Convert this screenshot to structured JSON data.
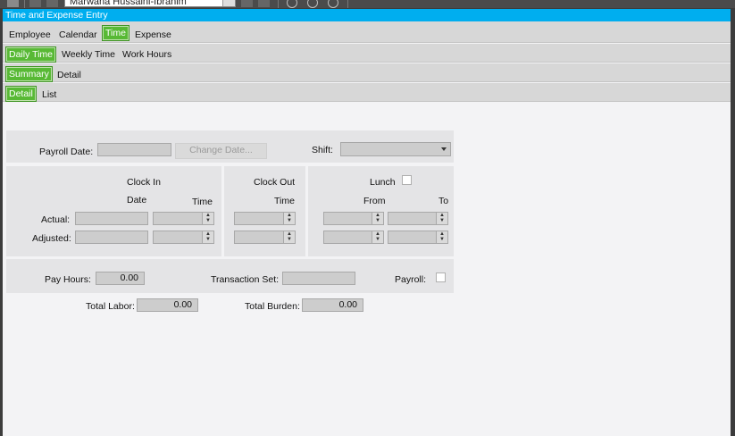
{
  "toolbar": {
    "user": "Marwana Hussaini-Ibrahim"
  },
  "window": {
    "title": "Time and Expense Entry"
  },
  "tabs_main": [
    {
      "label": "Employee"
    },
    {
      "label": "Calendar"
    },
    {
      "label": "Time"
    },
    {
      "label": "Expense"
    }
  ],
  "tabs_time": [
    {
      "label": "Daily Time"
    },
    {
      "label": "Weekly Time"
    },
    {
      "label": "Work Hours"
    }
  ],
  "tabs_daily": [
    {
      "label": "Summary"
    },
    {
      "label": "Detail"
    }
  ],
  "tabs_summary": [
    {
      "label": "Detail"
    },
    {
      "label": "List"
    }
  ],
  "form": {
    "payroll_date_label": "Payroll Date:",
    "change_date_button": "Change Date...",
    "shift_label": "Shift:",
    "clock_in_label": "Clock In",
    "clock_out_label": "Clock Out",
    "lunch_label": "Lunch",
    "date_label": "Date",
    "time_label": "Time",
    "from_label": "From",
    "to_label": "To",
    "actual_label": "Actual:",
    "adjusted_label": "Adjusted:",
    "pay_hours_label": "Pay Hours:",
    "pay_hours_value": "0.00",
    "transaction_set_label": "Transaction Set:",
    "payroll_label": "Payroll:",
    "total_labor_label": "Total Labor:",
    "total_labor_value": "0.00",
    "total_burden_label": "Total Burden:",
    "total_burden_value": "0.00"
  },
  "colors": {
    "accent": "#58b935",
    "title_bar": "#00aeef"
  }
}
